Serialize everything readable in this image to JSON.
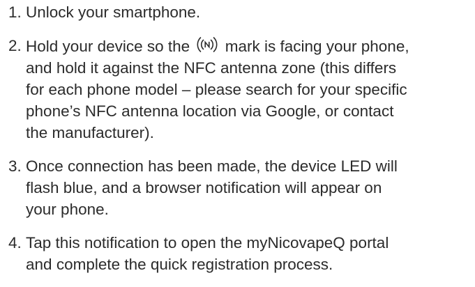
{
  "steps": [
    {
      "number": "1.",
      "lines": [
        "Unlock your smartphone."
      ]
    },
    {
      "number": "2.",
      "line1_before_icon": "Hold your device so the",
      "line1_after_icon": "mark is facing your phone,",
      "icon": "nfc-icon",
      "lines": [
        "and hold it against the NFC antenna zone (this differs",
        "for each phone model – please search for your specific",
        "phone’s NFC antenna location via Google, or contact",
        "the manufacturer)."
      ]
    },
    {
      "number": "3.",
      "lines": [
        "Once connection has been made, the device LED will",
        "flash blue, and a browser notification will appear on",
        "your phone."
      ]
    },
    {
      "number": "4.",
      "lines": [
        "Tap this notification to open the myNicovapeQ portal",
        "and complete the quick registration process."
      ]
    }
  ],
  "colors": {
    "text": "#2b2b2b",
    "background": "#ffffff"
  }
}
